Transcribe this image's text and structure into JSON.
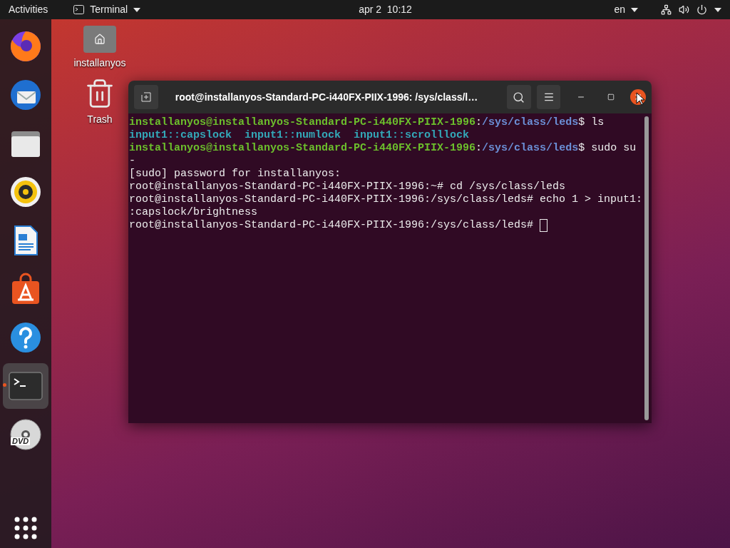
{
  "top_bar": {
    "activities": "Activities",
    "app_menu": "Terminal",
    "clock": "apr 2  10:12",
    "input_source": "en"
  },
  "dock": {
    "items": [
      {
        "kind": "firefox",
        "selected": false,
        "running": false
      },
      {
        "kind": "thunderbird",
        "selected": false,
        "running": false
      },
      {
        "kind": "files",
        "selected": false,
        "running": false
      },
      {
        "kind": "rhythmbox",
        "selected": false,
        "running": false
      },
      {
        "kind": "writer",
        "selected": false,
        "running": false
      },
      {
        "kind": "software",
        "selected": false,
        "running": false
      },
      {
        "kind": "help",
        "selected": false,
        "running": false
      },
      {
        "kind": "terminal",
        "selected": true,
        "running": true
      },
      {
        "kind": "dvd",
        "label": "DVD",
        "selected": false,
        "running": false
      }
    ]
  },
  "desktop": {
    "icons": [
      {
        "kind": "home",
        "label": "installanyos"
      },
      {
        "kind": "trash",
        "label": "Trash"
      }
    ]
  },
  "terminal": {
    "title": "root@installanyos-Standard-PC-i440FX-PIIX-1996: /sys/class/l…",
    "lines": [
      [
        {
          "kind": "user",
          "text": "installanyos@installanyos-Standard-PC-i440FX-PIIX-1996"
        },
        {
          "kind": "plain",
          "text": ":"
        },
        {
          "kind": "path",
          "text": "/sys/class/leds"
        },
        {
          "kind": "plain",
          "text": "$ ls"
        }
      ],
      [
        {
          "kind": "dir",
          "text": "input1::capslock"
        },
        {
          "kind": "dir",
          "text": "input1::numlock"
        },
        {
          "kind": "dir",
          "text": "input1::scrolllock"
        }
      ],
      [
        {
          "kind": "user",
          "text": "installanyos@installanyos-Standard-PC-i440FX-PIIX-1996"
        },
        {
          "kind": "plain",
          "text": ":"
        },
        {
          "kind": "path",
          "text": "/sys/class/leds"
        },
        {
          "kind": "plain",
          "text": "$ sudo su"
        }
      ],
      [
        {
          "kind": "plain",
          "text": "-"
        }
      ],
      [
        {
          "kind": "plain",
          "text": "[sudo] password for installanyos:"
        }
      ],
      [
        {
          "kind": "plain",
          "text": "root@installanyos-Standard-PC-i440FX-PIIX-1996:~# cd /sys/class/leds"
        }
      ],
      [
        {
          "kind": "plain",
          "text": "root@installanyos-Standard-PC-i440FX-PIIX-1996:/sys/class/leds# echo 1 > input1:"
        }
      ],
      [
        {
          "kind": "plain",
          "text": ":capslock/brightness"
        }
      ],
      [
        {
          "kind": "plain",
          "text": "root@installanyos-Standard-PC-i440FX-PIIX-1996:/sys/class/leds# "
        },
        {
          "kind": "cursor"
        }
      ]
    ]
  }
}
